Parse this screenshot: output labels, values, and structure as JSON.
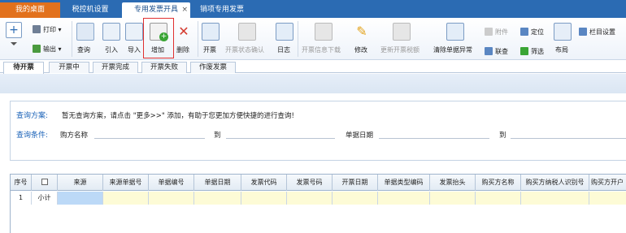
{
  "top_tabs": [
    {
      "label": "我的桌面"
    },
    {
      "label": "税控机设置"
    },
    {
      "label": "专用发票开具",
      "close": "×"
    },
    {
      "label": "销项专用发票"
    }
  ],
  "toolbar": {
    "print": "打印",
    "export": "输出",
    "query": "查询",
    "import": "引入",
    "import2": "导入",
    "add": "增加",
    "delete": "删除",
    "issue": "开票",
    "issue_status_confirm": "开票状态确认",
    "log": "日志",
    "invoice_info_download": "开票信息下载",
    "modify": "修改",
    "update_issue_tax": "更新开票税额",
    "clear_exception": "清除单据异常",
    "attachment": "附件",
    "link_query": "联查",
    "locate": "定位",
    "filter": "筛选",
    "column_settings": "栏目设置",
    "layout": "布局"
  },
  "sub_tabs": [
    "待开票",
    "开票中",
    "开票完成",
    "开票失败",
    "作废发票"
  ],
  "query": {
    "scheme_label": "查询方案:",
    "scheme_hint": "暂无查询方案，请点击 \"更多>>\" 添加，有助于您更加方便快捷的进行查询!",
    "condition_label": "查询条件:",
    "buyer_name": "购方名称",
    "to1": "到",
    "doc_date": "单据日期",
    "to2": "到"
  },
  "grid": {
    "headers": [
      "序号",
      "□",
      "来源",
      "来源单据号",
      "单据编号",
      "单据日期",
      "发票代码",
      "发票号码",
      "开票日期",
      "单据类型编码",
      "发票抬头",
      "购买方名称",
      "购买方纳税人识别号",
      "购买方开户"
    ],
    "rows": [
      {
        "seq": "1",
        "check": "小计"
      }
    ]
  },
  "colors": {
    "topbar": "#2b6bb3",
    "desk_tab": "#e2711d",
    "highlight": "#e03030",
    "label_blue": "#1b63b8",
    "subtotal_row": "#fdfbd6",
    "selected_cell": "#bcd9f7"
  }
}
